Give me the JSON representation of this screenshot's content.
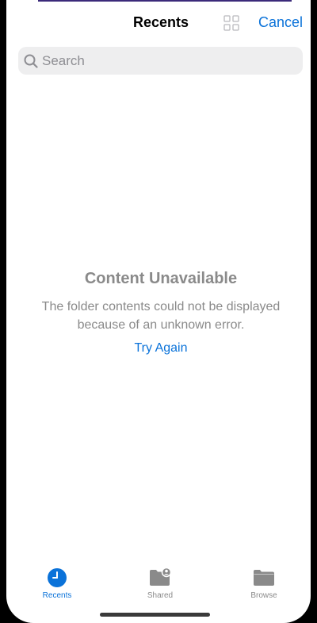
{
  "header": {
    "title": "Recents",
    "grid_icon": "grid-view-icon",
    "cancel_label": "Cancel"
  },
  "search": {
    "placeholder": "Search",
    "value": "",
    "icon": "magnifying-glass-icon"
  },
  "empty_state": {
    "title": "Content Unavailable",
    "message": "The folder contents could not be displayed because of an unknown error.",
    "action_label": "Try Again"
  },
  "tabs": [
    {
      "label": "Recents",
      "icon": "clock-icon",
      "active": true
    },
    {
      "label": "Shared",
      "icon": "shared-folder-icon",
      "active": false
    },
    {
      "label": "Browse",
      "icon": "folder-icon",
      "active": false
    }
  ],
  "colors": {
    "accent": "#0a72d9",
    "secondary_text": "#8a8a8a",
    "search_background": "#eeeeef",
    "background": "#ffffff"
  }
}
